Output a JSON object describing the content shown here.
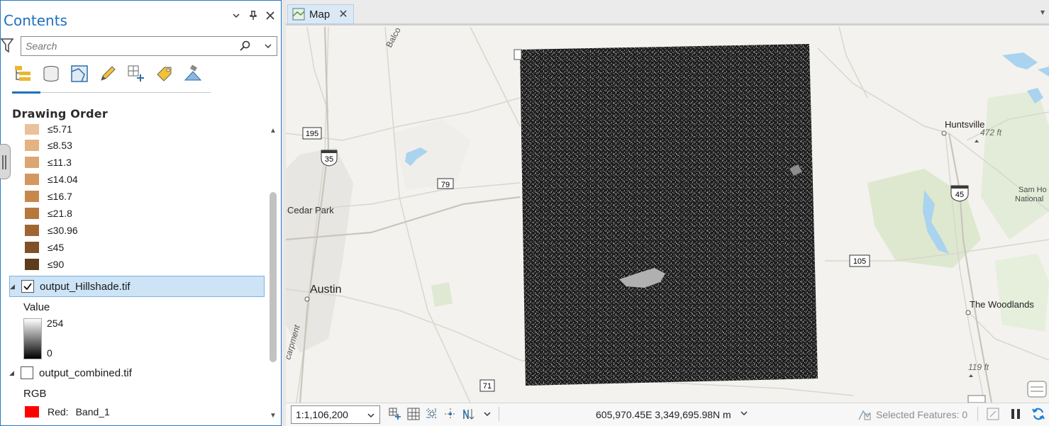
{
  "contents_pane": {
    "title": "Contents",
    "search_placeholder": "Search",
    "section_title": "Drawing Order",
    "tool_icons": [
      "list-by-drawing-order-icon",
      "list-by-source-icon",
      "list-by-selection-icon",
      "list-by-editing-icon",
      "list-by-snapping-icon",
      "list-by-labeling-icon",
      "list-by-perspective-imagery-icon"
    ],
    "legend_items": [
      {
        "label": "≤5.71",
        "color": "#e9c29a"
      },
      {
        "label": "≤8.53",
        "color": "#e3b383"
      },
      {
        "label": "≤11.3",
        "color": "#dca670"
      },
      {
        "label": "≤14.04",
        "color": "#d4975d"
      },
      {
        "label": "≤16.7",
        "color": "#c9884b"
      },
      {
        "label": "≤21.8",
        "color": "#b8773c"
      },
      {
        "label": "≤30.96",
        "color": "#a16531"
      },
      {
        "label": "≤45",
        "color": "#805027"
      },
      {
        "label": "≤90",
        "color": "#5e3b1c"
      }
    ],
    "layers": [
      {
        "name": "output_Hillshade.tif",
        "checked": true,
        "selected": true,
        "sub_label": "Value",
        "ramp_max": "254",
        "ramp_min": "0"
      },
      {
        "name": "output_combined.tif",
        "checked": false,
        "selected": false,
        "sub_label": "RGB",
        "band_channel": "Red:",
        "band_name": "Band_1",
        "band_color": "#ff0000"
      }
    ]
  },
  "map_view": {
    "tab_label": "Map",
    "place_labels": {
      "cedar_park": "Cedar Park",
      "austin": "Austin",
      "huntsville": "Huntsville",
      "the_woodlands": "The Woodlands",
      "sam_houston_1": "Sam Ho",
      "sam_houston_2": "National",
      "balcones": "Balco",
      "escarpment": "carpment",
      "elev_472": "472 ft",
      "elev_119": "119 ft"
    },
    "road_shields": {
      "us_195": "195",
      "i_35": "35",
      "us_79": "79",
      "i_45": "45",
      "us_105": "105",
      "us_71": "71"
    },
    "scale": "1:1,106,200",
    "coordinates": "605,970.45E 3,349,695.98N m",
    "selected_features": "Selected Features: 0"
  }
}
